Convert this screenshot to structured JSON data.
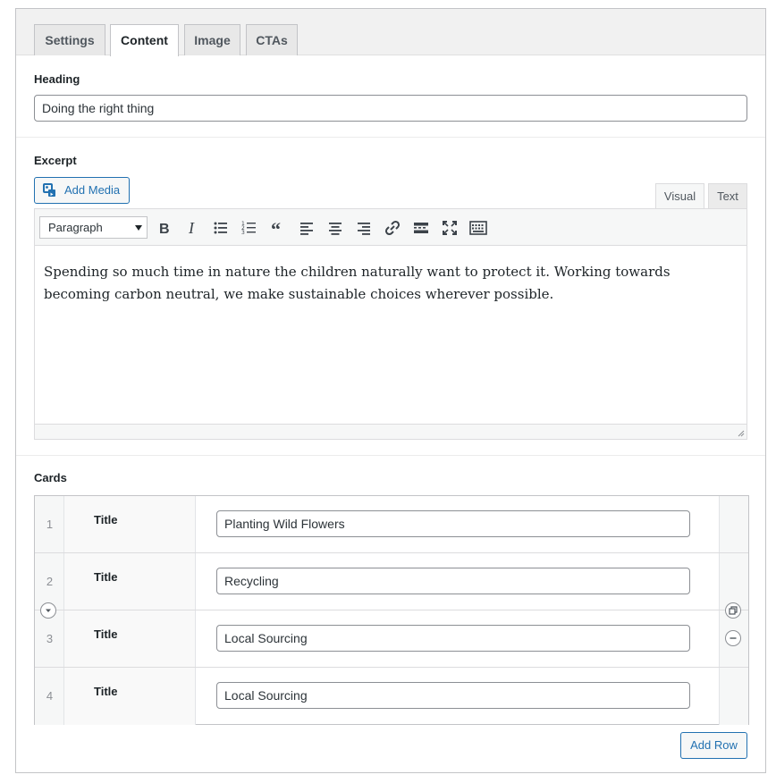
{
  "tabs": [
    {
      "label": "Settings",
      "active": false
    },
    {
      "label": "Content",
      "active": true
    },
    {
      "label": "Image",
      "active": false
    },
    {
      "label": "CTAs",
      "active": false
    }
  ],
  "heading": {
    "label": "Heading",
    "value": "Doing the right thing"
  },
  "excerpt": {
    "label": "Excerpt",
    "add_media_label": "Add Media",
    "mode_tabs": {
      "visual": "Visual",
      "text": "Text",
      "active": "visual"
    },
    "format_select": "Paragraph",
    "toolbar_buttons": [
      "bold-icon",
      "italic-icon",
      "bullet-list-icon",
      "numbered-list-icon",
      "blockquote-icon",
      "align-left-icon",
      "align-center-icon",
      "align-right-icon",
      "link-icon",
      "read-more-icon",
      "fullscreen-icon",
      "toolbar-toggle-icon"
    ],
    "content": "Spending so much time in nature the children naturally want to protect it. Working towards becoming carbon neutral, we make sustainable choices wherever possible."
  },
  "cards": {
    "label": "Cards",
    "rows": [
      {
        "index": "1",
        "field_label": "Title",
        "value": "Planting Wild Flowers"
      },
      {
        "index": "2",
        "field_label": "Title",
        "value": "Recycling"
      },
      {
        "index": "3",
        "field_label": "Title",
        "value": "Local Sourcing"
      },
      {
        "index": "4",
        "field_label": "Title",
        "value": "Local Sourcing"
      }
    ],
    "add_row_label": "Add Row"
  },
  "colors": {
    "accent": "#2271b1",
    "border": "#c3c4c7",
    "text": "#1d2327"
  }
}
